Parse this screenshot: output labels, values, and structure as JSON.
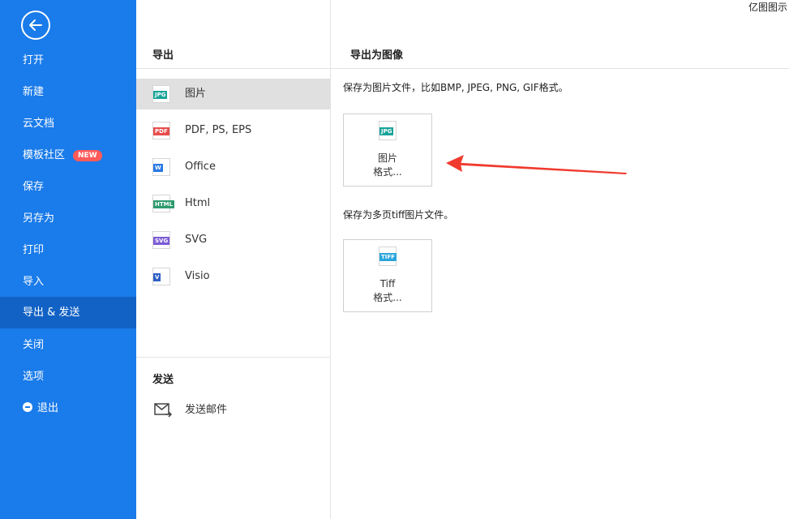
{
  "app_title": "亿图图示",
  "sidebar": {
    "items": [
      {
        "label": "打开"
      },
      {
        "label": "新建"
      },
      {
        "label": "云文档"
      },
      {
        "label": "模板社区",
        "badge": "NEW"
      },
      {
        "label": "保存"
      },
      {
        "label": "另存为"
      },
      {
        "label": "打印"
      },
      {
        "label": "导入"
      },
      {
        "label": "导出 & 发送",
        "active": true
      },
      {
        "label": "关闭"
      },
      {
        "label": "选项"
      },
      {
        "label": "退出"
      }
    ]
  },
  "export": {
    "heading": "导出",
    "formats": [
      {
        "label": "图片",
        "icon": "JPG",
        "color": "#1aa39a",
        "active": true
      },
      {
        "label": "PDF, PS, EPS",
        "icon": "PDF",
        "color": "#e84c4c"
      },
      {
        "label": "Office",
        "icon": "W",
        "color": "#2b78e4"
      },
      {
        "label": "Html",
        "icon": "HTML",
        "color": "#2e9b6e"
      },
      {
        "label": "SVG",
        "icon": "SVG",
        "color": "#7b5bd6"
      },
      {
        "label": "Visio",
        "icon": "V",
        "color": "#2d5fc4"
      }
    ]
  },
  "send": {
    "heading": "发送",
    "email_label": "发送邮件"
  },
  "content": {
    "heading": "导出为图像",
    "image_desc": "保存为图片文件，比如BMP, JPEG, PNG, GIF格式。",
    "image_tile": {
      "icon": "JPG",
      "line1": "图片",
      "line2": "格式..."
    },
    "tiff_desc": "保存为多页tiff图片文件。",
    "tiff_tile": {
      "icon": "TIFF",
      "line1": "Tiff",
      "line2": "格式..."
    }
  },
  "colors": {
    "sidebar": "#1a7bea",
    "sidebar_active": "#1262c5",
    "badge": "#ff5a5a",
    "arrow": "#f03a2e"
  }
}
